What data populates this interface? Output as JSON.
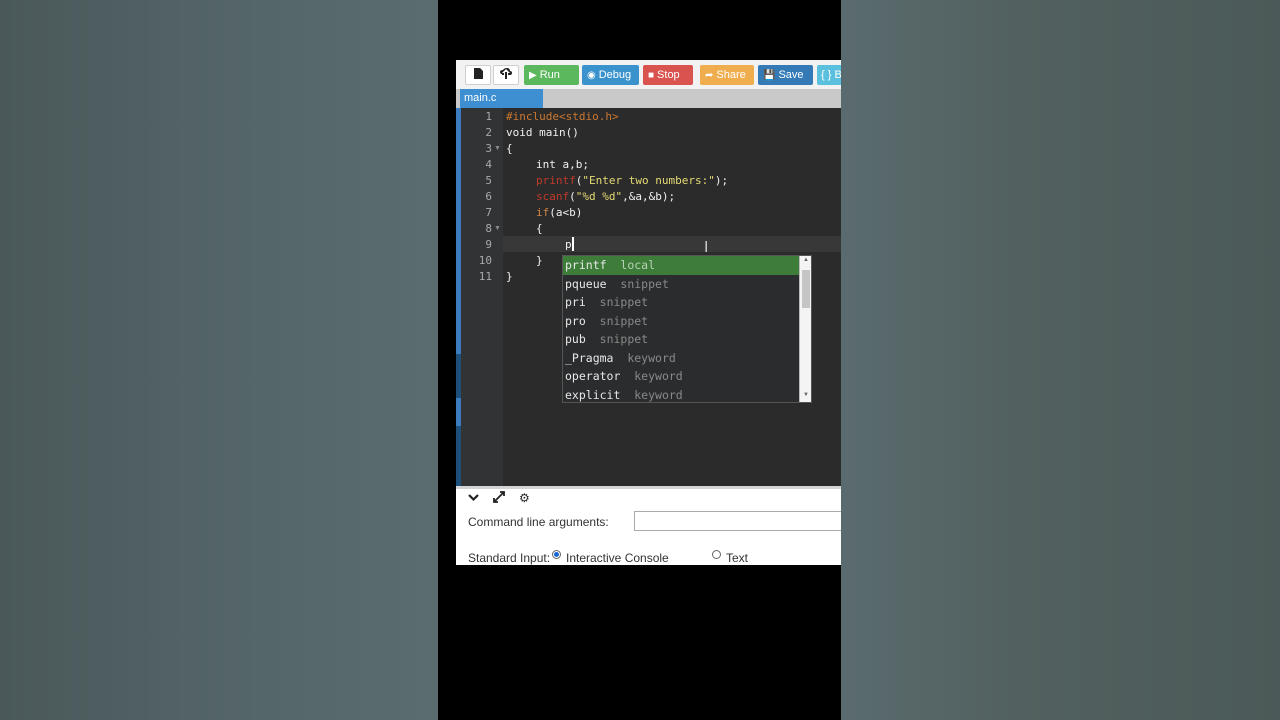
{
  "toolbar": {
    "new_file_icon": "file-icon",
    "upload_icon": "upload-icon",
    "run_label": "Run",
    "debug_label": "Debug",
    "stop_label": "Stop",
    "share_label": "Share",
    "save_label": "Save",
    "beautify_label": "{ } B",
    "colors": {
      "run": "#5cb85c",
      "debug": "#3a93cd",
      "stop": "#d9534f",
      "share": "#f0ad4e",
      "save": "#337ab7",
      "beautify": "#5bc0de"
    }
  },
  "tabs": [
    {
      "label": "main.c"
    }
  ],
  "editor": {
    "line_numbers": [
      "1",
      "2",
      "3",
      "4",
      "5",
      "6",
      "7",
      "8",
      "9",
      "10",
      "11"
    ],
    "lines": [
      "#include<stdio.h>",
      "void main()",
      "{",
      "    int a,b;",
      "    printf(\"Enter two numbers:\");",
      "    scanf(\"%d %d\",&a,&b);",
      "    if(a<b)",
      "    {",
      "        p",
      "    }",
      "}"
    ],
    "tokens": {
      "l1": "#include<stdio.h>",
      "l2": "void main()",
      "l3": "{",
      "l4": "int a,b;",
      "l5_fn": "printf",
      "l5_open": "(",
      "l5_str": "\"Enter two numbers:\"",
      "l5_close": ");",
      "l6_fn": "scanf",
      "l6_open": "(",
      "l6_str": "\"%d %d\"",
      "l6_rest": ",&a,&b);",
      "l7_kw": "if",
      "l7_rest": "(a<b)",
      "l8": "{",
      "l9": "p",
      "l10": "}",
      "l11": "}"
    }
  },
  "autocomplete": {
    "items": [
      {
        "name": "printf",
        "meta": "local"
      },
      {
        "name": "pqueue",
        "meta": "snippet"
      },
      {
        "name": "pri",
        "meta": "snippet"
      },
      {
        "name": "pro",
        "meta": "snippet"
      },
      {
        "name": "pub",
        "meta": "snippet"
      },
      {
        "name": "_Pragma",
        "meta": "keyword"
      },
      {
        "name": "operator",
        "meta": "keyword"
      },
      {
        "name": "explicit",
        "meta": "keyword"
      }
    ],
    "selected_index": 0
  },
  "bottom_panel": {
    "collapse_icon": "chevron-down-icon",
    "expand_icon": "expand-icon",
    "settings_icon": "gear-icon",
    "cmd_args_label": "Command line arguments:",
    "cmd_args_value": "",
    "stdin_label": "Standard Input:",
    "stdin_options": [
      "Interactive Console",
      "Text"
    ],
    "stdin_selected": "Interactive Console"
  }
}
